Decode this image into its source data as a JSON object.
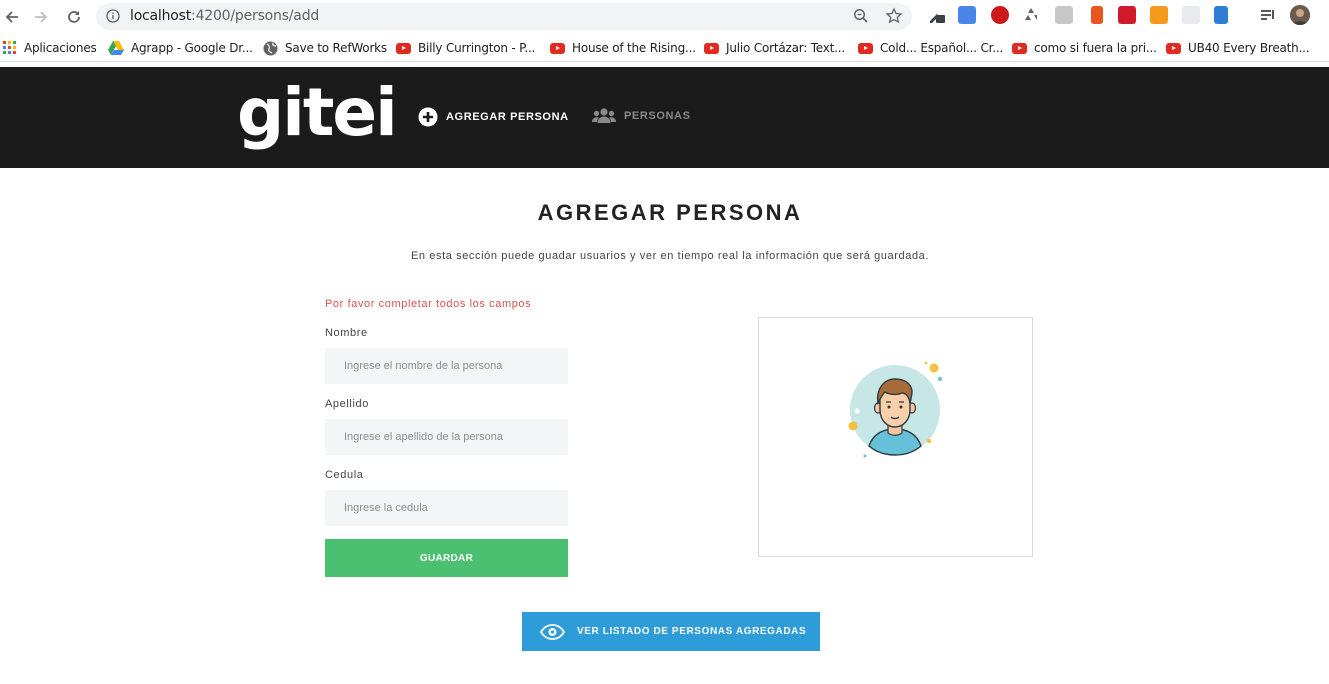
{
  "browser": {
    "url_host": "localhost",
    "url_path": ":4200/persons/add",
    "bookmarks": [
      {
        "label": "Aplicaciones",
        "icon": "apps-grid-icon"
      },
      {
        "label": "Agrapp - Google Dr...",
        "icon": "google-drive-icon"
      },
      {
        "label": "Save to RefWorks",
        "icon": "globe-icon"
      },
      {
        "label": "Billy Currington - P...",
        "icon": "youtube-icon"
      },
      {
        "label": "House of the Rising...",
        "icon": "youtube-icon"
      },
      {
        "label": "Julio Cortázar: Text...",
        "icon": "youtube-icon"
      },
      {
        "label": "Cold... Español... Cr...",
        "icon": "youtube-icon"
      },
      {
        "label": "como si fuera la pri...",
        "icon": "youtube-icon"
      },
      {
        "label": "UB40 Every Breath...",
        "icon": "youtube-icon"
      }
    ]
  },
  "header": {
    "logo": "gitei",
    "nav": [
      {
        "label": "AGREGAR PERSONA",
        "icon": "plus-circle-icon",
        "active": true
      },
      {
        "label": "PERSONAS",
        "icon": "users-icon",
        "active": false
      }
    ]
  },
  "page": {
    "title": "AGREGAR PERSONA",
    "subtitle": "En esta sección puede guadar usuarios y ver en tiempo real la información que será guardada.",
    "warning": "Por favor completar todos los campos",
    "fields": {
      "nombre": {
        "label": "Nombre",
        "placeholder": "Ingrese el nombre de la persona",
        "value": ""
      },
      "apellido": {
        "label": "Apellido",
        "placeholder": "Ingrese el apellido de la persona",
        "value": ""
      },
      "cedula": {
        "label": "Cedula",
        "placeholder": "Ingrese la cedula",
        "value": ""
      }
    },
    "save_label": "GUARDAR",
    "list_button_label": "VER LISTADO DE PERSONAS AGREGADAS"
  },
  "colors": {
    "header_bg": "#1b1b1b",
    "save_green": "#4cc071",
    "list_blue": "#2d9cd8",
    "warning_red": "#d9534f"
  }
}
